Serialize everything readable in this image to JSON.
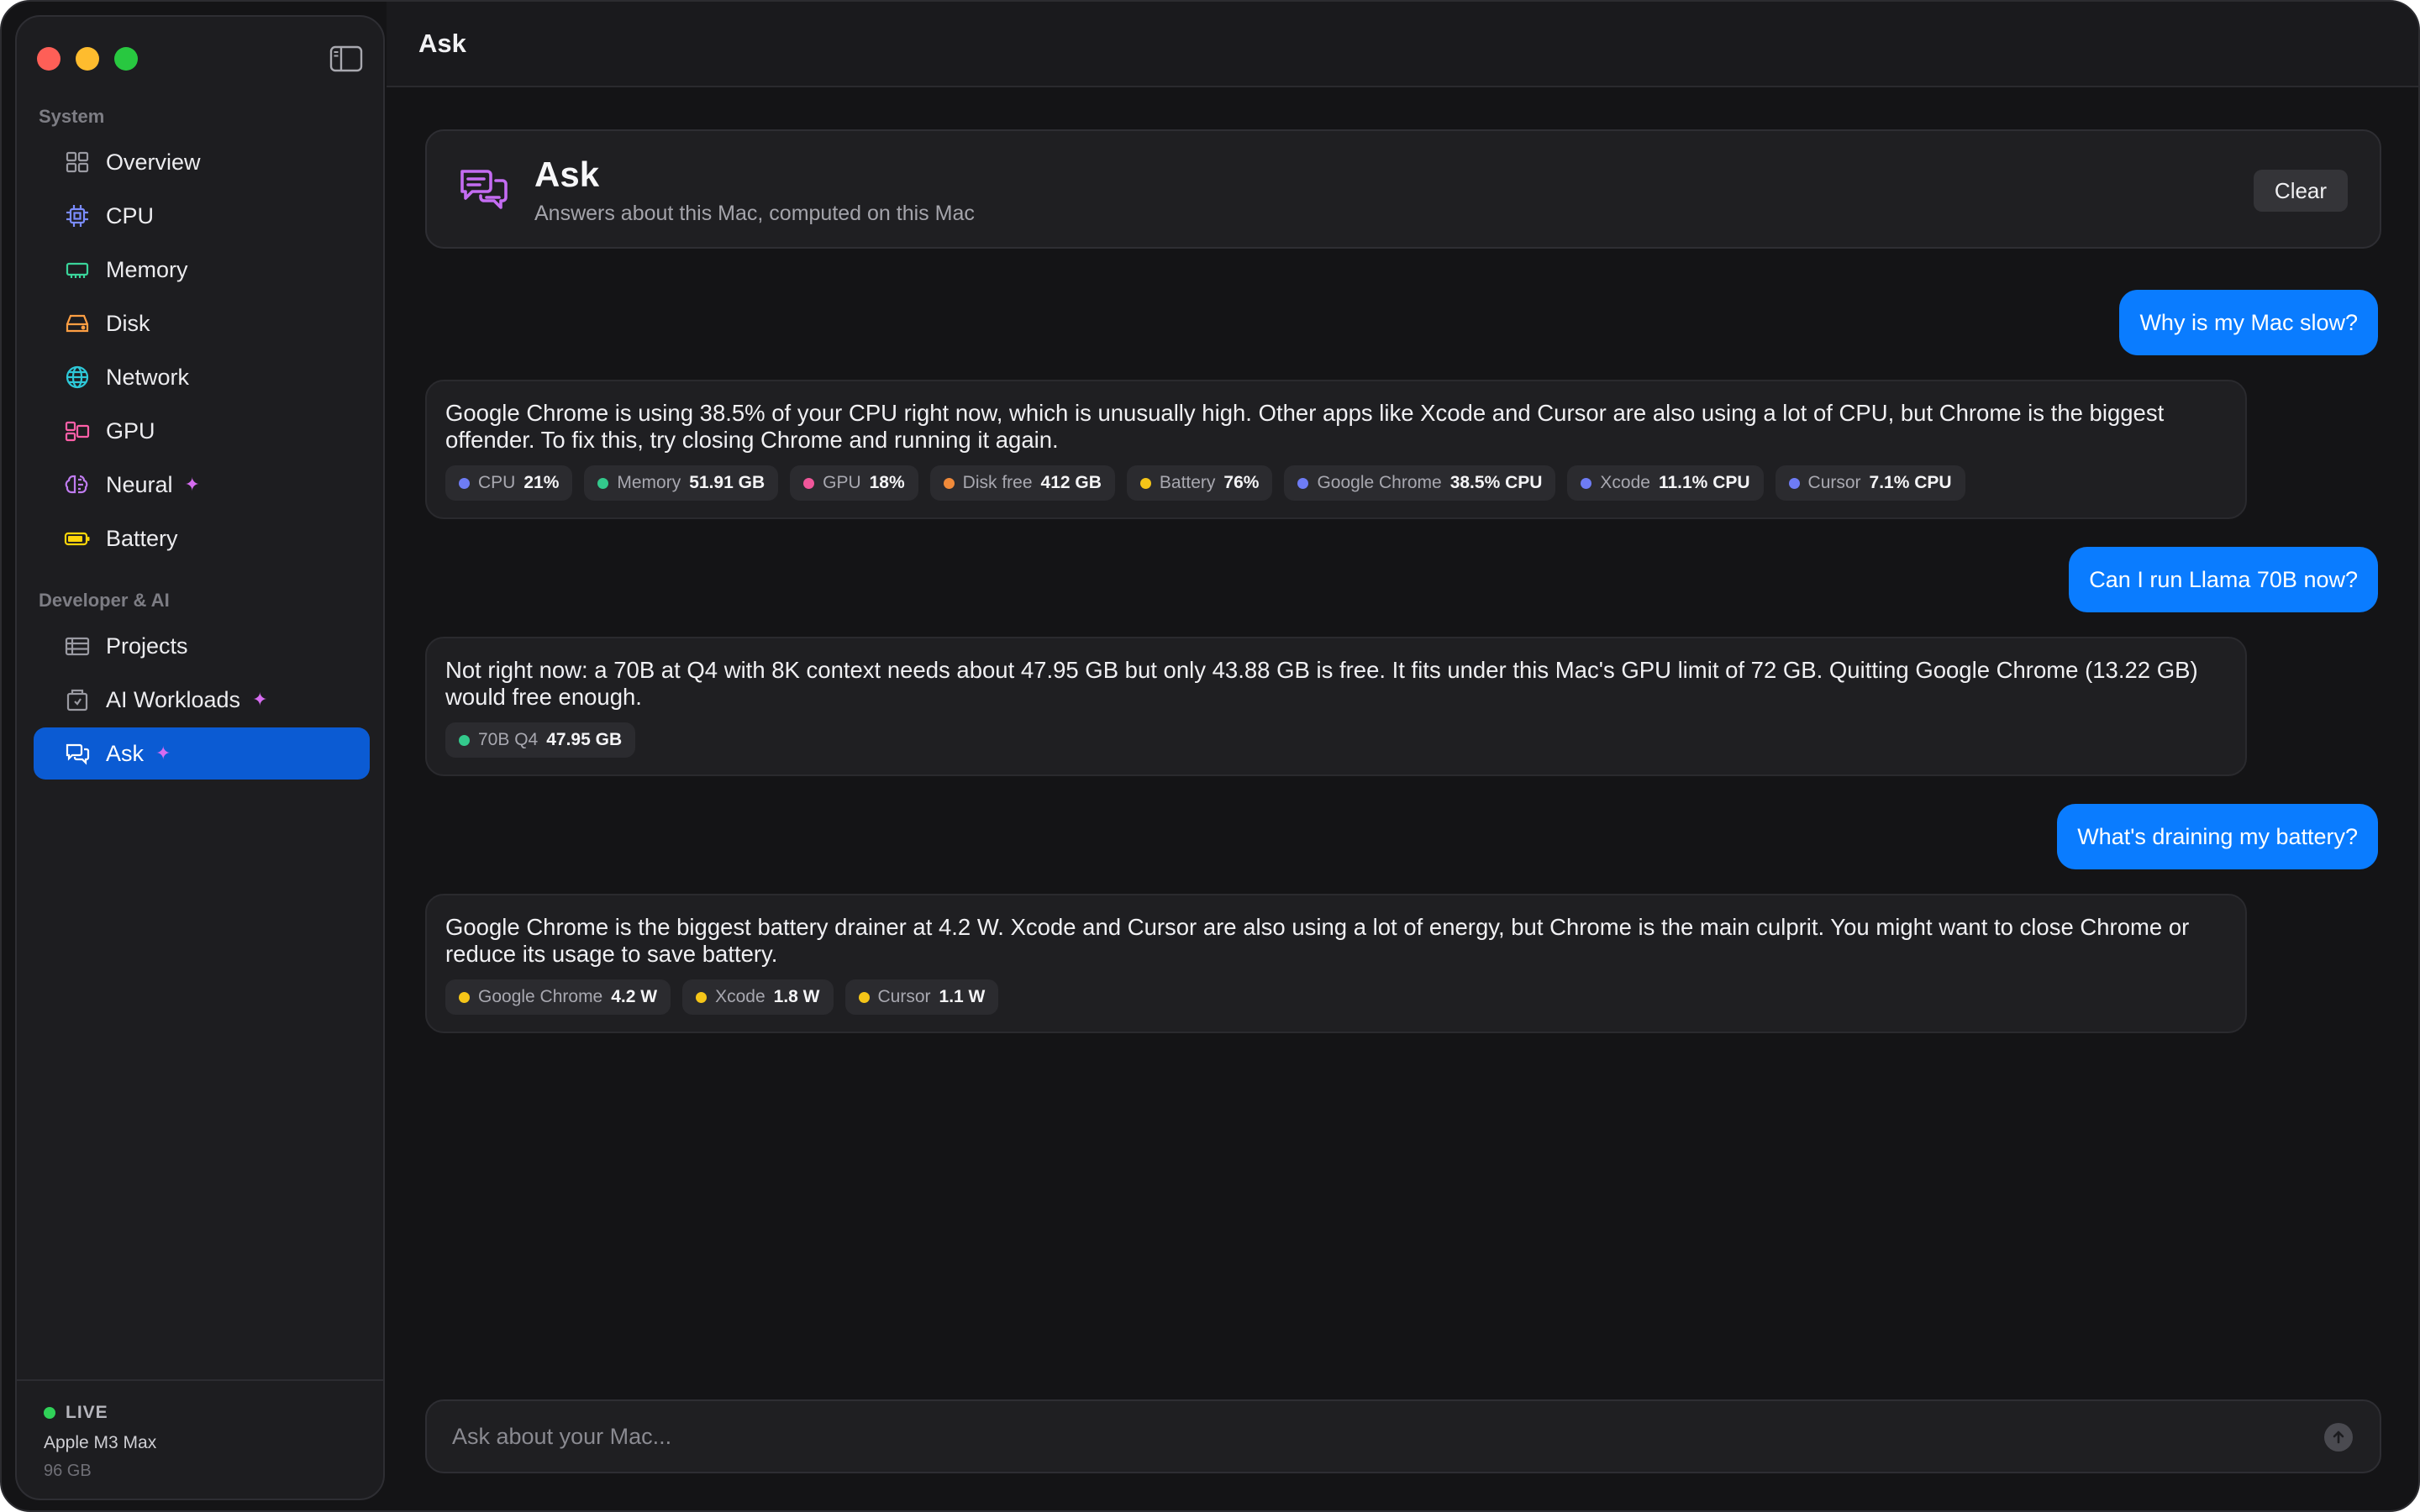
{
  "window": {
    "title": "Ask"
  },
  "sidebar": {
    "sections": [
      {
        "label": "System"
      },
      {
        "label": "Developer & AI"
      }
    ],
    "items": [
      {
        "label": "Overview",
        "icon": "grid-icon",
        "color": "#9a9aa2"
      },
      {
        "label": "CPU",
        "icon": "cpu-icon",
        "color": "#7b8cff"
      },
      {
        "label": "Memory",
        "icon": "memory-icon",
        "color": "#3ad49a"
      },
      {
        "label": "Disk",
        "icon": "disk-icon",
        "color": "#ff9f43"
      },
      {
        "label": "Network",
        "icon": "globe-icon",
        "color": "#2ec8d8"
      },
      {
        "label": "GPU",
        "icon": "gpu-icon",
        "color": "#ff5fa8"
      },
      {
        "label": "Neural",
        "icon": "brain-icon",
        "color": "#c07cf0",
        "sparkle": "✦"
      },
      {
        "label": "Battery",
        "icon": "battery-icon",
        "color": "#ffd60a"
      },
      {
        "label": "Projects",
        "icon": "projects-icon",
        "color": "#9a9aa2"
      },
      {
        "label": "AI Workloads",
        "icon": "workloads-icon",
        "color": "#9a9aa2",
        "sparkle": "✦"
      },
      {
        "label": "Ask",
        "icon": "chat-icon",
        "color": "#ffffff",
        "sparkle": "✦",
        "active": true
      }
    ],
    "footer": {
      "status": "LIVE",
      "chip": "Apple M3 Max",
      "memory": "96 GB"
    }
  },
  "header": {
    "title": "Ask",
    "subtitle": "Answers about this Mac, computed on this Mac",
    "clear_label": "Clear"
  },
  "conversation": [
    {
      "question": "Why is my Mac slow?",
      "answer": "Google Chrome is using 38.5% of your CPU right now, which is unusually high. Other apps like Xcode and Cursor are also using a lot of CPU, but Chrome is the biggest offender. To fix this, try closing Chrome and running it again.",
      "chips": [
        {
          "label": "CPU",
          "value": "21%",
          "color": "#6e7cf5"
        },
        {
          "label": "Memory",
          "value": "51.91 GB",
          "color": "#33c98c"
        },
        {
          "label": "GPU",
          "value": "18%",
          "color": "#f0569a"
        },
        {
          "label": "Disk free",
          "value": "412 GB",
          "color": "#f08a3a"
        },
        {
          "label": "Battery",
          "value": "76%",
          "color": "#f5c518"
        },
        {
          "label": "Google Chrome",
          "value": "38.5% CPU",
          "color": "#6e7cf5"
        },
        {
          "label": "Xcode",
          "value": "11.1% CPU",
          "color": "#6e7cf5"
        },
        {
          "label": "Cursor",
          "value": "7.1% CPU",
          "color": "#6e7cf5"
        }
      ]
    },
    {
      "question": "Can I run Llama 70B now?",
      "answer": "Not right now: a 70B at Q4 with 8K context needs about 47.95 GB but only 43.88 GB is free. It fits under this Mac's GPU limit of 72 GB. Quitting Google Chrome (13.22 GB) would free enough.",
      "chips": [
        {
          "label": "70B Q4",
          "value": "47.95 GB",
          "color": "#33c98c"
        }
      ]
    },
    {
      "question": "What's draining my battery?",
      "answer": "Google Chrome is the biggest battery drainer at 4.2 W. Xcode and Cursor are also using a lot of energy, but Chrome is the main culprit. You might want to close Chrome or reduce its usage to save battery.",
      "chips": [
        {
          "label": "Google Chrome",
          "value": "4.2 W",
          "color": "#f5c518"
        },
        {
          "label": "Xcode",
          "value": "1.8 W",
          "color": "#f5c518"
        },
        {
          "label": "Cursor",
          "value": "1.1 W",
          "color": "#f5c518"
        }
      ]
    }
  ],
  "composer": {
    "placeholder": "Ask about your Mac..."
  }
}
